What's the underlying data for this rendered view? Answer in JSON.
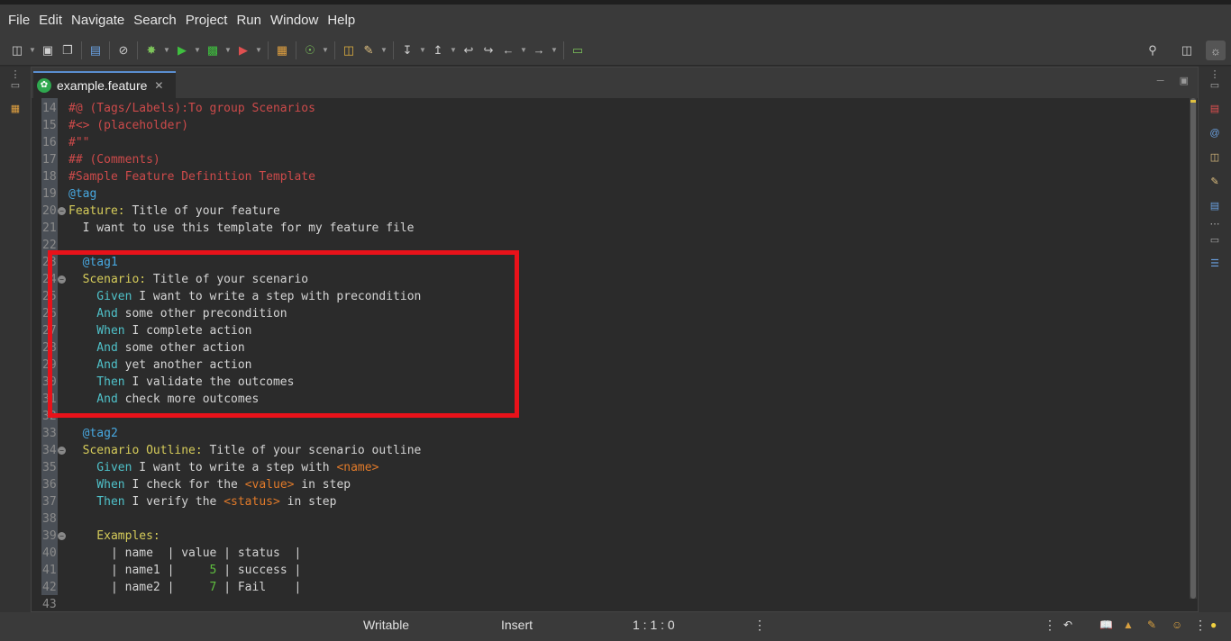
{
  "menu": [
    "File",
    "Edit",
    "Navigate",
    "Search",
    "Project",
    "Run",
    "Window",
    "Help"
  ],
  "editor": {
    "tab_label": "example.feature",
    "lines": [
      {
        "n": "14",
        "fold": false,
        "segs": [
          {
            "c": "c-comment",
            "t": "#@ (Tags/Labels):To group Scenarios"
          }
        ]
      },
      {
        "n": "15",
        "fold": false,
        "segs": [
          {
            "c": "c-comment",
            "t": "#<> (placeholder)"
          }
        ]
      },
      {
        "n": "16",
        "fold": false,
        "segs": [
          {
            "c": "c-comment",
            "t": "#\"\""
          }
        ]
      },
      {
        "n": "17",
        "fold": false,
        "segs": [
          {
            "c": "c-comment",
            "t": "## (Comments)"
          }
        ]
      },
      {
        "n": "18",
        "fold": false,
        "segs": [
          {
            "c": "c-comment",
            "t": "#Sample Feature Definition Template"
          }
        ]
      },
      {
        "n": "19",
        "fold": false,
        "segs": [
          {
            "c": "c-tag",
            "t": "@tag"
          }
        ]
      },
      {
        "n": "20",
        "fold": true,
        "segs": [
          {
            "c": "c-kw",
            "t": "Feature:"
          },
          {
            "c": "c-text",
            "t": " Title of your feature"
          }
        ]
      },
      {
        "n": "21",
        "fold": false,
        "segs": [
          {
            "c": "c-text",
            "t": "  I want to use this template for my feature file"
          }
        ]
      },
      {
        "n": "22",
        "fold": false,
        "segs": []
      },
      {
        "n": "23",
        "fold": false,
        "segs": [
          {
            "c": "c-tag",
            "t": "  @tag1"
          }
        ]
      },
      {
        "n": "24",
        "fold": true,
        "segs": [
          {
            "c": "c-kw",
            "t": "  Scenario:"
          },
          {
            "c": "c-text",
            "t": " Title of your scenario"
          }
        ]
      },
      {
        "n": "25",
        "fold": false,
        "segs": [
          {
            "c": "c-step",
            "t": "    Given"
          },
          {
            "c": "c-text",
            "t": " I want to write a step with precondition"
          }
        ]
      },
      {
        "n": "26",
        "fold": false,
        "segs": [
          {
            "c": "c-step",
            "t": "    And"
          },
          {
            "c": "c-text",
            "t": " some other precondition"
          }
        ]
      },
      {
        "n": "27",
        "fold": false,
        "segs": [
          {
            "c": "c-step",
            "t": "    When"
          },
          {
            "c": "c-text",
            "t": " I complete action"
          }
        ]
      },
      {
        "n": "28",
        "fold": false,
        "segs": [
          {
            "c": "c-step",
            "t": "    And"
          },
          {
            "c": "c-text",
            "t": " some other action"
          }
        ]
      },
      {
        "n": "29",
        "fold": false,
        "segs": [
          {
            "c": "c-step",
            "t": "    And"
          },
          {
            "c": "c-text",
            "t": " yet another action"
          }
        ]
      },
      {
        "n": "30",
        "fold": false,
        "segs": [
          {
            "c": "c-step",
            "t": "    Then"
          },
          {
            "c": "c-text",
            "t": " I validate the outcomes"
          }
        ]
      },
      {
        "n": "31",
        "fold": false,
        "segs": [
          {
            "c": "c-step",
            "t": "    And"
          },
          {
            "c": "c-text",
            "t": " check more outcomes"
          }
        ]
      },
      {
        "n": "32",
        "fold": false,
        "segs": []
      },
      {
        "n": "33",
        "fold": false,
        "segs": [
          {
            "c": "c-tag",
            "t": "  @tag2"
          }
        ]
      },
      {
        "n": "34",
        "fold": true,
        "segs": [
          {
            "c": "c-kw",
            "t": "  Scenario Outline:"
          },
          {
            "c": "c-text",
            "t": " Title of your scenario outline"
          }
        ]
      },
      {
        "n": "35",
        "fold": false,
        "segs": [
          {
            "c": "c-step",
            "t": "    Given"
          },
          {
            "c": "c-text",
            "t": " I want to write a step with "
          },
          {
            "c": "c-ph",
            "t": "<name>"
          }
        ]
      },
      {
        "n": "36",
        "fold": false,
        "segs": [
          {
            "c": "c-step",
            "t": "    When"
          },
          {
            "c": "c-text",
            "t": " I check for the "
          },
          {
            "c": "c-ph",
            "t": "<value>"
          },
          {
            "c": "c-text",
            "t": " in step"
          }
        ]
      },
      {
        "n": "37",
        "fold": false,
        "segs": [
          {
            "c": "c-step",
            "t": "    Then"
          },
          {
            "c": "c-text",
            "t": " I verify the "
          },
          {
            "c": "c-ph",
            "t": "<status>"
          },
          {
            "c": "c-text",
            "t": " in step"
          }
        ]
      },
      {
        "n": "38",
        "fold": false,
        "segs": []
      },
      {
        "n": "39",
        "fold": true,
        "segs": [
          {
            "c": "c-kw",
            "t": "    Examples:"
          }
        ]
      },
      {
        "n": "40",
        "fold": false,
        "segs": [
          {
            "c": "c-text",
            "t": "      | name  | value | status  |"
          }
        ]
      },
      {
        "n": "41",
        "fold": false,
        "segs": [
          {
            "c": "c-text",
            "t": "      | name1 |     "
          },
          {
            "c": "c-num",
            "t": "5"
          },
          {
            "c": "c-text",
            "t": " | success |"
          }
        ]
      },
      {
        "n": "42",
        "fold": false,
        "segs": [
          {
            "c": "c-text",
            "t": "      | name2 |     "
          },
          {
            "c": "c-num",
            "t": "7"
          },
          {
            "c": "c-text",
            "t": " | Fail    |"
          }
        ]
      },
      {
        "n": "43",
        "fold": false,
        "segs": []
      }
    ]
  },
  "status": {
    "writable": "Writable",
    "insert": "Insert",
    "position": "1 : 1 : 0"
  },
  "colors": {
    "highlight_box": "#e8121a",
    "tab_accent": "#5a8ed0"
  }
}
